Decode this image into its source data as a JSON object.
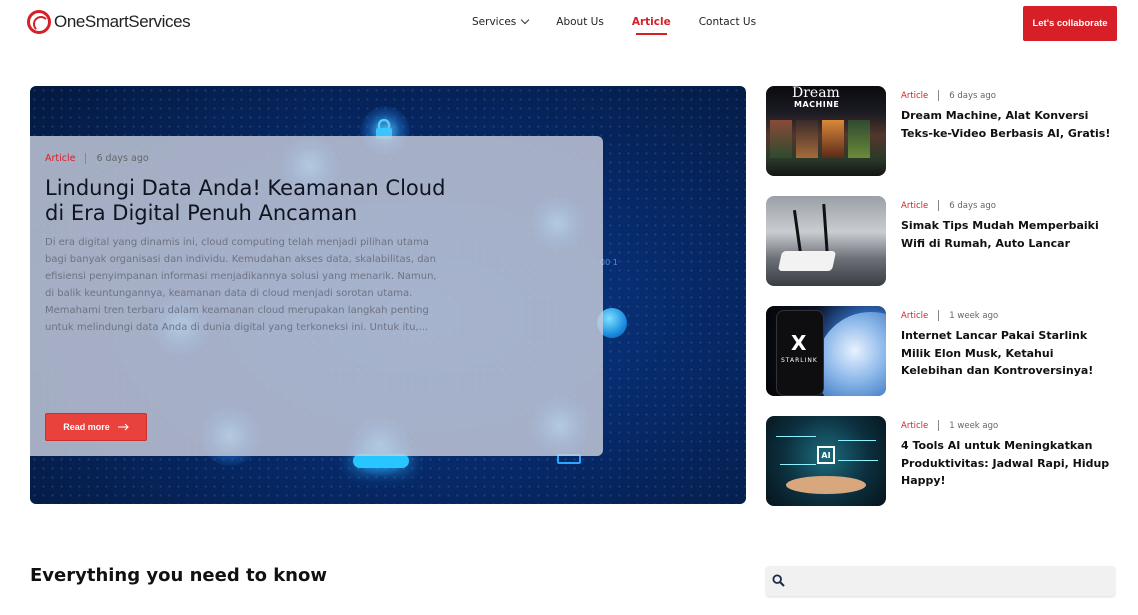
{
  "brand": {
    "logo_text": "OneSmartServices",
    "accent": "#d61f26"
  },
  "nav": {
    "items": [
      {
        "label": "Services",
        "has_dropdown": true,
        "active": false
      },
      {
        "label": "About Us",
        "has_dropdown": false,
        "active": false
      },
      {
        "label": "Article",
        "has_dropdown": false,
        "active": true
      },
      {
        "label": "Contact Us",
        "has_dropdown": false,
        "active": false
      }
    ],
    "cta_label": "Let's collaborate"
  },
  "hero": {
    "category": "Article",
    "date": "6 days ago",
    "title": "Lindungi Data Anda! Keamanan Cloud di Era Digital Penuh Ancaman",
    "excerpt": "Di era digital yang dinamis ini, cloud computing telah menjadi pilihan utama bagi banyak organisasi dan individu. Kemudahan akses data, skalabilitas, dan efisiensi penyimpanan informasi menjadikannya solusi yang menarik. Namun, di balik keuntungannya, keamanan data di cloud menjadi sorotan utama. Memahami tren terbaru dalam keamanan cloud merupakan langkah penting untuk melindungi data Anda di dunia digital yang terkoneksi ini. Untuk itu,...",
    "read_more_label": "Read more",
    "background_text": "00 1"
  },
  "sidebar": {
    "articles": [
      {
        "category": "Article",
        "date": "6 days ago",
        "title": "Dream Machine, Alat Konversi Teks-ke-Video Berbasis AI, Gratis!",
        "thumb_text": "Dream",
        "thumb_sub": "MACHINE"
      },
      {
        "category": "Article",
        "date": "6 days ago",
        "title": "Simak Tips Mudah Memperbaiki Wifi di Rumah, Auto Lancar"
      },
      {
        "category": "Article",
        "date": "1 week ago",
        "title": "Internet Lancar Pakai Starlink Milik Elon Musk, Ketahui Kelebihan dan Kontroversinya!",
        "thumb_text": "X",
        "thumb_sub": "STARLINK"
      },
      {
        "category": "Article",
        "date": "1 week ago",
        "title": "4 Tools AI untuk Meningkatkan Produktivitas: Jadwal Rapi, Hidup Happy!",
        "thumb_text": "AI"
      }
    ]
  },
  "section": {
    "title": "Everything you need to know"
  },
  "search": {
    "placeholder": "",
    "value": "",
    "icon": "search-icon"
  }
}
